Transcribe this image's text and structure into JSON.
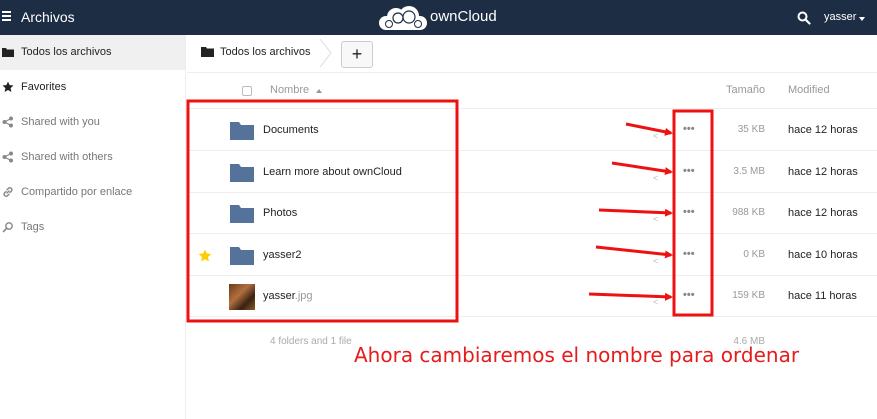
{
  "header": {
    "app_title": "Archivos",
    "logo_text": "ownCloud",
    "user_name": "yasser"
  },
  "sidebar": {
    "items": [
      {
        "label": "Todos los archivos",
        "icon": "folder-icon",
        "active": true
      },
      {
        "label": "Favorites",
        "icon": "star-icon"
      },
      {
        "label": "Shared with you",
        "icon": "share-icon"
      },
      {
        "label": "Shared with others",
        "icon": "share-icon"
      },
      {
        "label": "Compartido por enlace",
        "icon": "link-icon"
      },
      {
        "label": "Tags",
        "icon": "tag-icon"
      }
    ]
  },
  "breadcrumb": {
    "label": "Todos los archivos",
    "new_button": "+"
  },
  "table": {
    "columns": {
      "name": "Nombre",
      "size": "Tamaño",
      "modified": "Modified"
    },
    "rows": [
      {
        "name": "Documents",
        "ext": "",
        "type": "folder",
        "favorite": false,
        "more": "•••",
        "size": "35 KB",
        "modified": "hace 12 horas"
      },
      {
        "name": "Learn more about ownCloud",
        "ext": "",
        "type": "folder",
        "favorite": false,
        "more": "•••",
        "size": "3.5 MB",
        "modified": "hace 12 horas"
      },
      {
        "name": "Photos",
        "ext": "",
        "type": "folder",
        "favorite": false,
        "more": "•••",
        "size": "988 KB",
        "modified": "hace 12 horas"
      },
      {
        "name": "yasser2",
        "ext": "",
        "type": "folder",
        "favorite": true,
        "more": "•••",
        "size": "0 KB",
        "modified": "hace 10 horas"
      },
      {
        "name": "yasser",
        "ext": ".jpg",
        "type": "image",
        "favorite": false,
        "more": "•••",
        "size": "159 KB",
        "modified": "hace 11 horas"
      }
    ],
    "summary": {
      "label": "4 folders and 1 file",
      "size": "4.6 MB"
    }
  },
  "annotation": {
    "text": "Ahora cambiaremos el nombre para ordenar",
    "color": "#e51c1c"
  },
  "colors": {
    "header_bg": "#1d2d44",
    "folder": "#55739a",
    "star": "#fc0"
  }
}
